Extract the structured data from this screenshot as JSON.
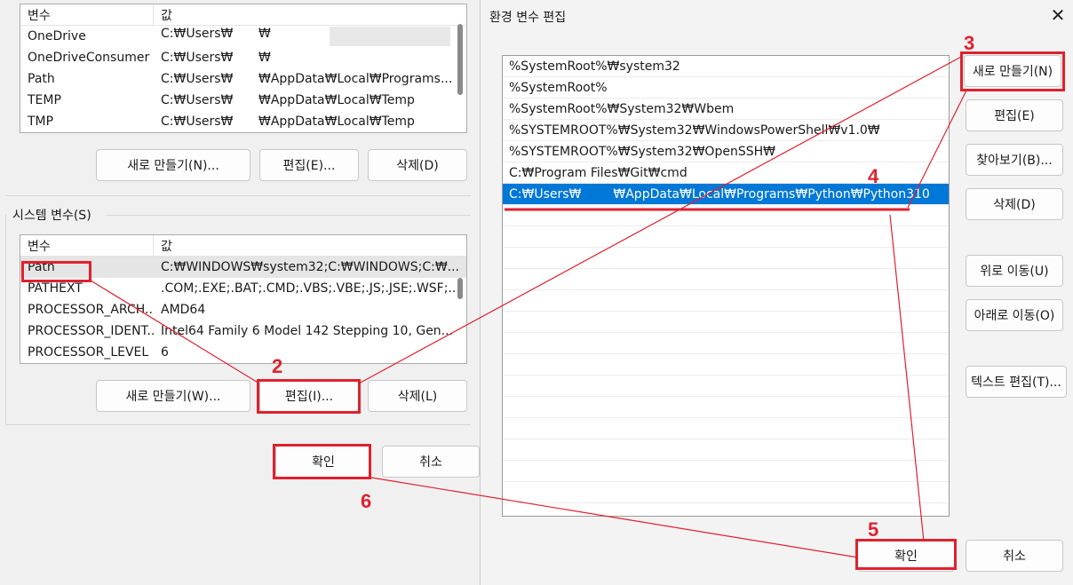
{
  "user_vars": {
    "header": {
      "name": "변수",
      "value": "값"
    },
    "rows": [
      {
        "name": "OneDrive",
        "value_a": "C:₩Users₩",
        "value_b": "₩"
      },
      {
        "name": "OneDriveConsumer",
        "value_a": "C:₩Users₩",
        "value_b": "₩"
      },
      {
        "name": "Path",
        "value_a": "C:₩Users₩",
        "value_b": "₩AppData₩Local₩Programs..."
      },
      {
        "name": "TEMP",
        "value_a": "C:₩Users₩",
        "value_b": "₩AppData₩Local₩Temp"
      },
      {
        "name": "TMP",
        "value_a": "C:₩Users₩",
        "value_b": "₩AppData₩Local₩Temp"
      }
    ],
    "buttons": {
      "new": "새로 만들기(N)...",
      "edit": "편집(E)...",
      "delete": "삭제(D)"
    }
  },
  "system_vars": {
    "title": "시스템 변수(S)",
    "header": {
      "name": "변수",
      "value": "값"
    },
    "rows": [
      {
        "name": "Path",
        "value": "C:₩WINDOWS₩system32;C:₩WINDOWS;C:₩..."
      },
      {
        "name": "PATHEXT",
        "value": ".COM;.EXE;.BAT;.CMD;.VBS;.VBE;.JS;.JSE;.WSF;..."
      },
      {
        "name": "PROCESSOR_ARCH...",
        "value": "AMD64"
      },
      {
        "name": "PROCESSOR_IDENT...",
        "value": "Intel64 Family 6 Model 142 Stepping 10, Gen..."
      },
      {
        "name": "PROCESSOR_LEVEL",
        "value": "6"
      }
    ],
    "buttons": {
      "new": "새로 만들기(W)...",
      "edit": "편집(I)...",
      "delete": "삭제(L)"
    }
  },
  "left_footer": {
    "ok": "확인",
    "cancel": "취소"
  },
  "edit_dialog": {
    "title": "환경 변수 편집",
    "close": "✕",
    "paths": [
      "%SystemRoot%₩system32",
      "%SystemRoot%",
      "%SystemRoot%₩System32₩Wbem",
      "%SYSTEMROOT%₩System32₩WindowsPowerShell₩v1.0₩",
      "%SYSTEMROOT%₩System32₩OpenSSH₩",
      "C:₩Program Files₩Git₩cmd"
    ],
    "selected_path": {
      "a": "C:₩Users₩",
      "b": "₩AppData₩Local₩Programs₩Python₩Python310"
    },
    "buttons": {
      "new": "새로 만들기(N)",
      "edit": "편집(E)",
      "browse": "찾아보기(B)...",
      "delete": "삭제(D)",
      "up": "위로 이동(U)",
      "down": "아래로 이동(O)",
      "text_edit": "텍스트 편집(T)...",
      "ok": "확인",
      "cancel": "취소"
    }
  },
  "annotations": {
    "n2": "2",
    "n3": "3",
    "n4": "4",
    "n5": "5",
    "n6": "6",
    "color": "#e0212e"
  },
  "colors": {
    "selection": "#0078d7",
    "dialog_bg": "#f0f0f0"
  }
}
